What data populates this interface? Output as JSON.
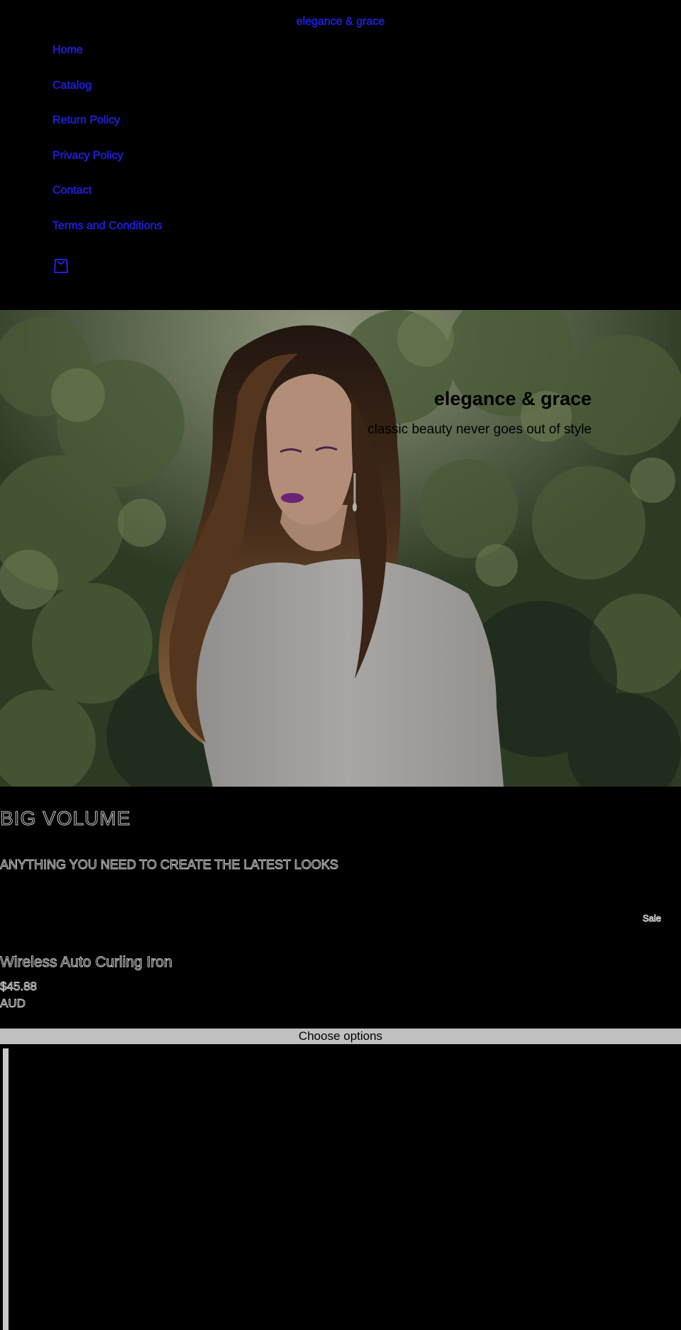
{
  "header": {
    "brand": "elegance & grace",
    "nav": [
      {
        "label": "Home"
      },
      {
        "label": "Catalog"
      },
      {
        "label": "Return Policy"
      },
      {
        "label": "Privacy Policy"
      },
      {
        "label": "Contact"
      },
      {
        "label": "Terms and Conditions"
      }
    ],
    "cart_icon": "shopping-bag-icon"
  },
  "hero": {
    "title": "elegance & grace",
    "subtitle": "classic beauty never goes out of style"
  },
  "collection": {
    "title": "BIG VOLUME",
    "description": "ANYTHING YOU NEED TO CREATE THE LATEST LOOKS"
  },
  "product": {
    "badge": "Sale",
    "title": "Wireless Auto Curling Iron",
    "price": "$45.88",
    "currency": "AUD",
    "button_label": "Choose options"
  },
  "colors": {
    "page_background": "#000000",
    "link": "#1a1acc",
    "button_background": "#c0c0c0",
    "outline_text": "#c8c8c8"
  }
}
